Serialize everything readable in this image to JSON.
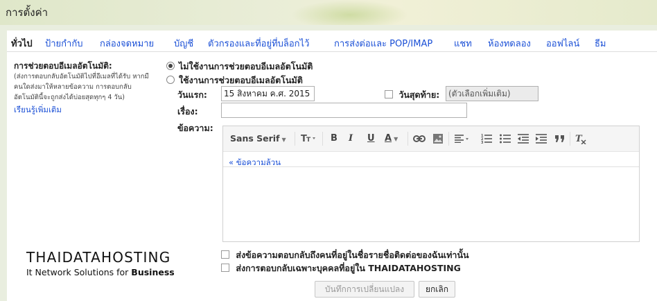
{
  "page_title": "การตั้งค่า",
  "tabs": [
    {
      "label": "ทั่วไป",
      "active": true
    },
    {
      "label": "ป้ายกำกับ"
    },
    {
      "label": "กล่องจดหมาย"
    },
    {
      "label": "บัญชี"
    },
    {
      "label": "ตัวกรองและที่อยู่ที่บล็อกไว้"
    },
    {
      "label": "การส่งต่อและ POP/IMAP"
    },
    {
      "label": "แชท"
    },
    {
      "label": "ห้องทดลอง"
    },
    {
      "label": "ออฟไลน์"
    },
    {
      "label": "ธีม"
    }
  ],
  "vacation": {
    "title": "การช่วยตอบอีเมลอัตโนมัติ:",
    "desc_lines": [
      "(ส่งการตอบกลับอัตโนมัติไปที่อีเมลที่ได้รับ หากมี",
      "คนใดส่งมาให้หลายข้อความ การตอบกลับ",
      "อัตโนมัตินี้จะถูกส่งได้บ่อยสุดทุกๆ 4 วัน)"
    ],
    "learn_more": "เรียนรู้เพิ่มเติม",
    "radio_off": "ไม่ใช้งานการช่วยตอบอีเมลอัตโนมัติ",
    "radio_on": "ใช้งานการช่วยตอบอีเมลอัตโนมัติ",
    "first_day_label": "วันแรก:",
    "first_day_value": "15 สิงหาคม ค.ศ. 2015",
    "last_day_label": "วันสุดท้าย:",
    "last_day_value": "(ตัวเลือกเพิ่มเติม)",
    "subject_label": "เรื่อง:",
    "subject_value": "",
    "message_label": "ข้อความ:",
    "plain_text_link": "« ข้อความล้วน",
    "option_contacts": "ส่งข้อความตอบกลับถึงคนที่อยู่ในชื่อรายชื่อติดต่อของฉันเท่านั้น",
    "option_domain": "ส่งการตอบกลับเฉพาะบุคคลที่อยู่ใน THAIDATAHOSTING"
  },
  "toolbar": {
    "font": "Sans Serif",
    "size_icon": "text-size-icon",
    "bold": "B",
    "italic": "I",
    "underline": "U",
    "text_color": "A"
  },
  "logo": {
    "main": "THAIDATAHOSTING",
    "sub_prefix": "It Network Solutions for ",
    "sub_bold": "Business"
  },
  "buttons": {
    "save": "บันทึกการเปลี่ยนแปลง",
    "cancel": "ยกเลิก"
  }
}
